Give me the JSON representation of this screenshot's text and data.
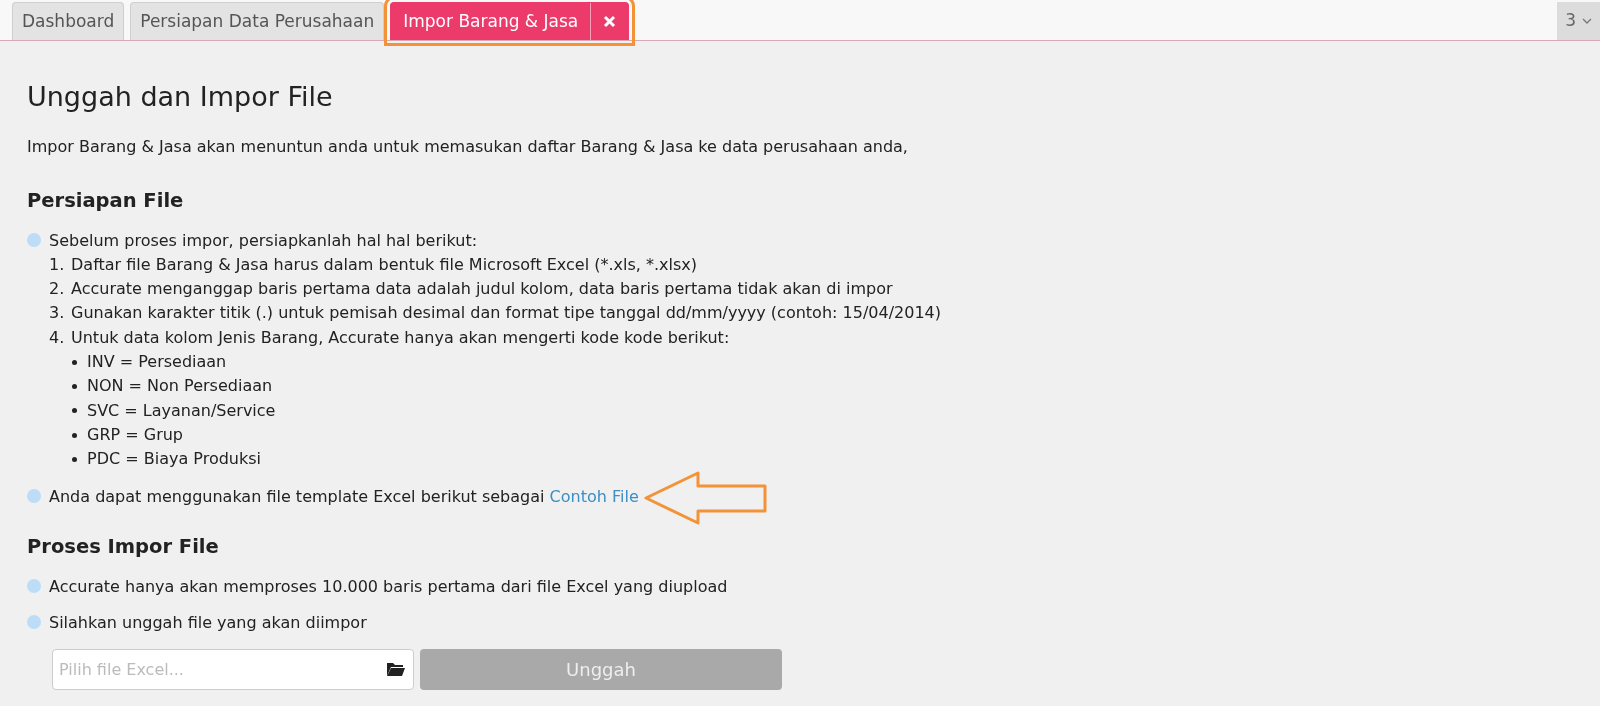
{
  "tabs": [
    {
      "label": "Dashboard",
      "selected": false,
      "closable": false,
      "highlighted": false
    },
    {
      "label": "Persiapan Data Perusahaan",
      "selected": false,
      "closable": false,
      "highlighted": false
    },
    {
      "label": "Impor Barang & Jasa",
      "selected": true,
      "closable": true,
      "highlighted": true
    }
  ],
  "tab_overflow": {
    "count": "3"
  },
  "page": {
    "title": "Unggah dan Impor File",
    "intro": "Impor Barang & Jasa akan menuntun anda untuk memasukan daftar Barang & Jasa ke data perusahaan anda,",
    "sections": [
      {
        "heading": "Persiapan File",
        "bullets": [
          {
            "text": "Sebelum proses impor, persiapkanlah hal hal berikut:",
            "steps": [
              {
                "number": "1.",
                "text": "Daftar file Barang & Jasa harus dalam bentuk file Microsoft Excel (*.xls, *.xlsx)"
              },
              {
                "number": "2.",
                "text": "Accurate menganggap baris pertama data adalah judul kolom, data baris pertama tidak akan di impor"
              },
              {
                "number": "3.",
                "text": "Gunakan karakter titik (.) untuk pemisah desimal dan format tipe tanggal dd/mm/yyyy (contoh: 15/04/2014)"
              },
              {
                "number": "4.",
                "text": "Untuk data kolom Jenis Barang, Accurate hanya akan mengerti kode kode berikut:",
                "codes": [
                  "INV = Persediaan",
                  "NON = Non Persediaan",
                  "SVC = Layanan/Service",
                  "GRP = Grup",
                  "PDC = Biaya Produksi"
                ]
              }
            ]
          },
          {
            "text": "Anda dapat menggunakan file template Excel berikut sebagai",
            "link": "Contoh File",
            "pointer_arrow": true
          }
        ]
      },
      {
        "heading": "Proses Impor File",
        "bullets": [
          {
            "text": "Accurate hanya akan memproses 10.000 baris pertama dari file Excel yang diupload"
          },
          {
            "text": "Silahkan unggah file yang akan diimpor"
          }
        ],
        "upload": {
          "placeholder": "Pilih file Excel...",
          "button": "Unggah",
          "disabled": true
        }
      }
    ]
  }
}
